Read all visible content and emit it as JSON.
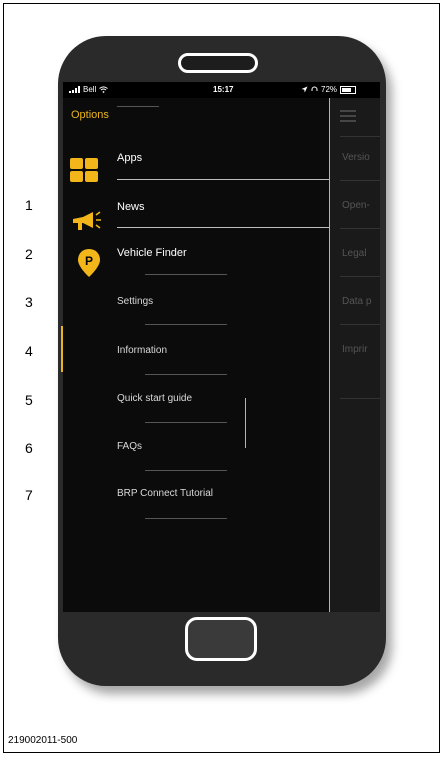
{
  "status_bar": {
    "carrier": "Bell",
    "time": "15:17",
    "battery": "72%"
  },
  "menu": {
    "title": "Options",
    "items": [
      {
        "label": "Apps",
        "icon": "apps-grid-icon"
      },
      {
        "label": "News",
        "icon": "megaphone-icon"
      },
      {
        "label": "Vehicle Finder",
        "icon": "parking-pin-icon"
      },
      {
        "label": "Settings"
      },
      {
        "label": "Information"
      },
      {
        "label": "Quick start guide"
      },
      {
        "label": "FAQs"
      },
      {
        "label": "BRP Connect Tutorial"
      }
    ]
  },
  "side_panel": {
    "items": [
      "Versio",
      "Open-",
      "Legal",
      "Data p",
      "Imprir"
    ]
  },
  "callouts": [
    "1",
    "2",
    "3",
    "4",
    "5",
    "6",
    "7"
  ],
  "caption": "219002011-500",
  "colors": {
    "accent": "#e9b51b",
    "screen_bg": "#000000",
    "phone_body": "#2a2a2a"
  }
}
